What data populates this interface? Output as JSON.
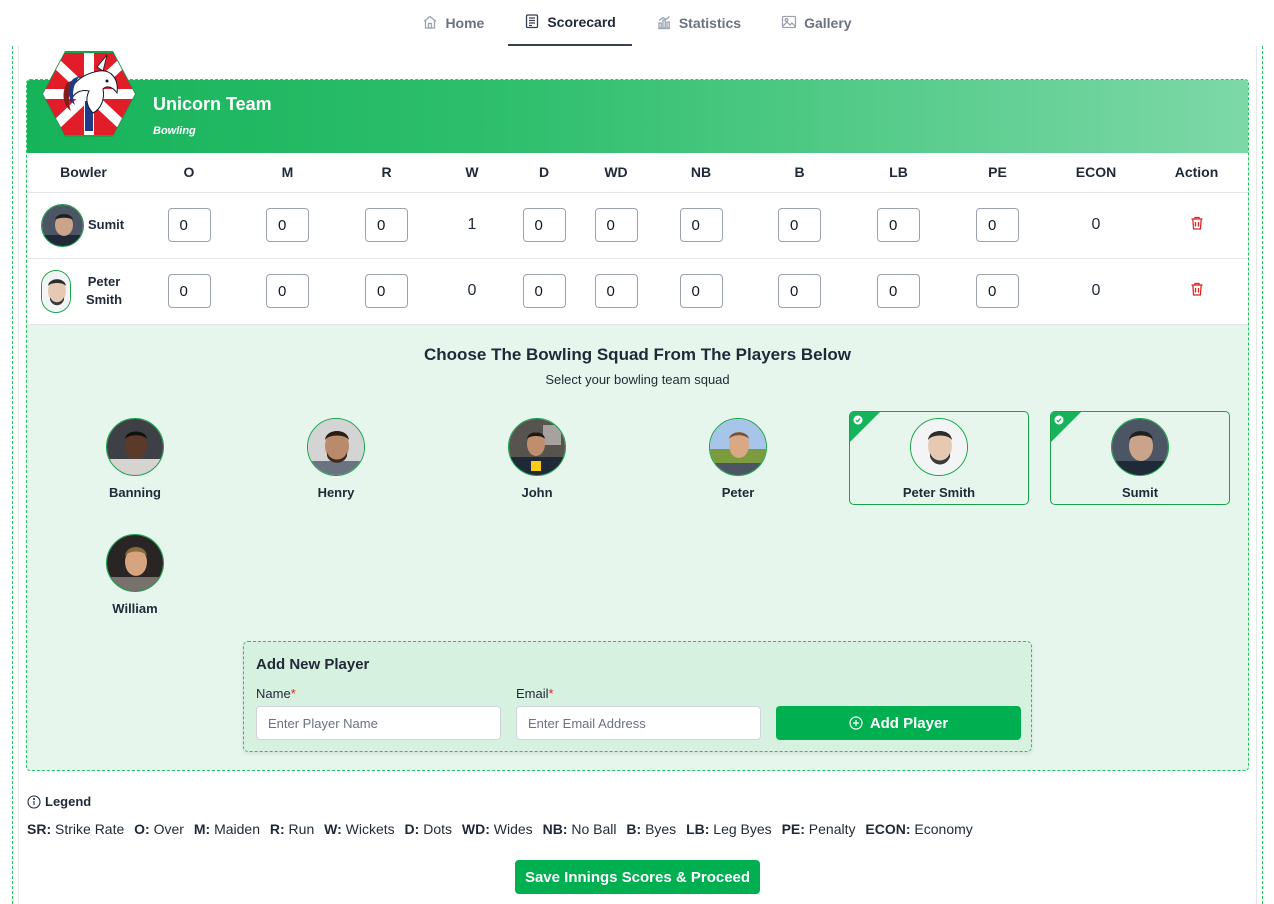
{
  "nav": {
    "tabs": [
      {
        "label": "Home",
        "icon": "home-icon"
      },
      {
        "label": "Scorecard",
        "icon": "scorecard-icon",
        "active": true
      },
      {
        "label": "Statistics",
        "icon": "statistics-icon"
      },
      {
        "label": "Gallery",
        "icon": "gallery-icon"
      }
    ]
  },
  "team": {
    "name": "Unicorn Team",
    "role": "Bowling"
  },
  "table": {
    "headers": [
      "Bowler",
      "O",
      "M",
      "R",
      "W",
      "D",
      "WD",
      "NB",
      "B",
      "LB",
      "PE",
      "ECON",
      "Action"
    ],
    "rows": [
      {
        "bowler": "Sumit",
        "O": "0",
        "M": "0",
        "R": "0",
        "W": "1",
        "D": "0",
        "WD": "0",
        "NB": "0",
        "B": "0",
        "LB": "0",
        "PE": "0",
        "ECON": "0"
      },
      {
        "bowler": "Peter Smith",
        "O": "0",
        "M": "0",
        "R": "0",
        "W": "0",
        "D": "0",
        "WD": "0",
        "NB": "0",
        "B": "0",
        "LB": "0",
        "PE": "0",
        "ECON": "0"
      }
    ]
  },
  "squad": {
    "title": "Choose The Bowling Squad From The Players Below",
    "subtitle": "Select your bowling team squad",
    "players": [
      {
        "name": "Banning",
        "selected": false
      },
      {
        "name": "Henry",
        "selected": false
      },
      {
        "name": "John",
        "selected": false
      },
      {
        "name": "Peter",
        "selected": false
      },
      {
        "name": "Peter Smith",
        "selected": true
      },
      {
        "name": "Sumit",
        "selected": true
      },
      {
        "name": "William",
        "selected": false
      }
    ]
  },
  "add_player": {
    "title": "Add New Player",
    "name_label": "Name",
    "name_placeholder": "Enter Player Name",
    "email_label": "Email",
    "email_placeholder": "Enter Email Address",
    "required_mark": "*",
    "button_label": "Add Player"
  },
  "legend": {
    "title": "Legend",
    "items": [
      {
        "key": "SR:",
        "value": "Strike Rate"
      },
      {
        "key": "O:",
        "value": "Over"
      },
      {
        "key": "M:",
        "value": "Maiden"
      },
      {
        "key": "R:",
        "value": "Run"
      },
      {
        "key": "W:",
        "value": "Wickets"
      },
      {
        "key": "D:",
        "value": "Dots"
      },
      {
        "key": "WD:",
        "value": "Wides"
      },
      {
        "key": "NB:",
        "value": "No Ball"
      },
      {
        "key": "B:",
        "value": "Byes"
      },
      {
        "key": "LB:",
        "value": "Leg Byes"
      },
      {
        "key": "PE:",
        "value": "Penalty"
      },
      {
        "key": "ECON:",
        "value": "Economy"
      }
    ]
  },
  "save_button": "Save Innings Scores & Proceed",
  "colors": {
    "brand_green": "#00b050",
    "panel_bg": "#e6f6ec",
    "delete_red": "#dc2626"
  }
}
